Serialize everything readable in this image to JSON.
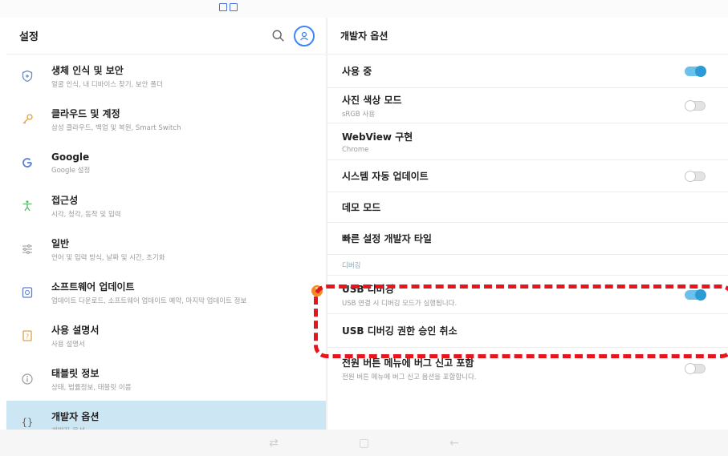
{
  "colors": {
    "accent": "#2b9bd6",
    "active_bg": "#cde6f4",
    "badge": "#f28c28",
    "annotation": "#e8141b"
  },
  "left": {
    "title": "설정",
    "items": [
      {
        "title": "생체 인식 및 보안",
        "subtitle": "얼굴 인식, 내 디바이스 찾기, 보안 폴더",
        "icon": "shield-icon"
      },
      {
        "title": "클라우드 및 계정",
        "subtitle": "삼성 클라우드, 백업 및 복원, Smart Switch",
        "icon": "key-icon"
      },
      {
        "title": "Google",
        "subtitle": "Google 설정",
        "icon": "google-icon"
      },
      {
        "title": "접근성",
        "subtitle": "시각, 청각, 동작 및 입력",
        "icon": "accessibility-icon"
      },
      {
        "title": "일반",
        "subtitle": "언어 및 입력 방식, 날짜 및 시간, 초기화",
        "icon": "sliders-icon"
      },
      {
        "title": "소프트웨어 업데이트",
        "subtitle": "업데이트 다운로드, 소프트웨어 업데이트 예약, 마지막 업데이트 정보",
        "icon": "update-icon",
        "badge": "1"
      },
      {
        "title": "사용 설명서",
        "subtitle": "사용 설명서",
        "icon": "manual-icon"
      },
      {
        "title": "태블릿 정보",
        "subtitle": "상태, 법률정보, 태블릿 이름",
        "icon": "info-icon"
      },
      {
        "title": "개발자 옵션",
        "subtitle": "개발자 옵션",
        "icon": "braces-icon",
        "active": true
      }
    ]
  },
  "right": {
    "title": "개발자 옵션",
    "rows": [
      {
        "title": "사용 중",
        "toggle": "on"
      },
      {
        "title": "사진 색상 모드",
        "subtitle": "sRGB 사용",
        "toggle": "off"
      },
      {
        "title": "WebView 구현",
        "subtitle": "Chrome"
      },
      {
        "title": "시스템 자동 업데이트",
        "toggle": "off"
      },
      {
        "title": "데모 모드"
      },
      {
        "title": "빠른 설정 개발자 타일"
      }
    ],
    "section_label": "디버깅",
    "debug_rows": [
      {
        "title": "USB 디버깅",
        "subtitle": "USB 연결 시 디버깅 모드가 실행됩니다.",
        "toggle": "on"
      },
      {
        "title": "USB 디버깅 권한 승인 취소"
      },
      {
        "title": "전원 버튼 메뉴에 버그 신고 포함",
        "subtitle": "전원 버튼 메뉴에 버그 신고 옵션을 포함합니다.",
        "toggle": "off"
      }
    ]
  },
  "navbar": {
    "recent": "⇄",
    "home": "▢",
    "back": "←"
  }
}
